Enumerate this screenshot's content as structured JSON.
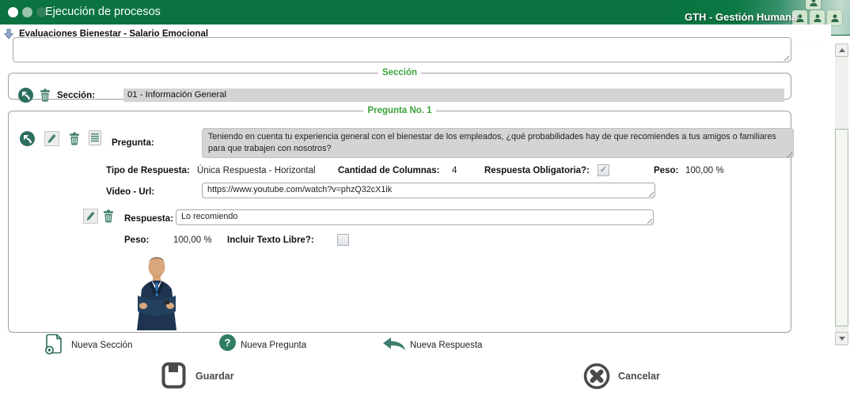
{
  "window": {
    "title": "Ejecución de procesos",
    "brand": "GTH - Gestión Humana"
  },
  "breadcrumb": {
    "title": "Evaluaciones Bienestar - Salario Emocional"
  },
  "description_box": {
    "value": ""
  },
  "section": {
    "legend": "Sección",
    "label": "Sección:",
    "value": "01 - Información General"
  },
  "question": {
    "legend": "Pregunta No. 1",
    "label": "Pregunta:",
    "text": "Teniendo en cuenta tu experiencia general con el bienestar de los empleados, ¿qué probabilidades hay de que recomiendes a tus amigos o familiares para que trabajen con nosotros?",
    "response_type_label": "Tipo de Respuesta:",
    "response_type_value": "Única Respuesta - Horizontal",
    "columns_label": "Cantidad de Columnas:",
    "columns_value": "4",
    "required_label": "Respuesta Obligatoria?:",
    "required_check": "✓",
    "weight_label": "Peso:",
    "weight_value": "100,00 %",
    "video_label": "Video - Url:",
    "video_value": "https://www.youtube.com/watch?v=phzQ32cX1ik"
  },
  "answer": {
    "label": "Respuesta:",
    "value": "Lo recomiendo",
    "weight_label": "Peso:",
    "weight_value": "100,00 %",
    "free_text_label": "Incluir Texto Libre?:",
    "free_text_check": ""
  },
  "actions": {
    "new_section": "Nueva Sección",
    "new_question": "Nueva Pregunta",
    "new_answer": "Nueva Respuesta",
    "save": "Guardar",
    "cancel": "Cancelar"
  },
  "colors": {
    "header_green": "#0a7340",
    "legend_green": "#3aa339",
    "icon_teal": "#3d7c6f"
  }
}
